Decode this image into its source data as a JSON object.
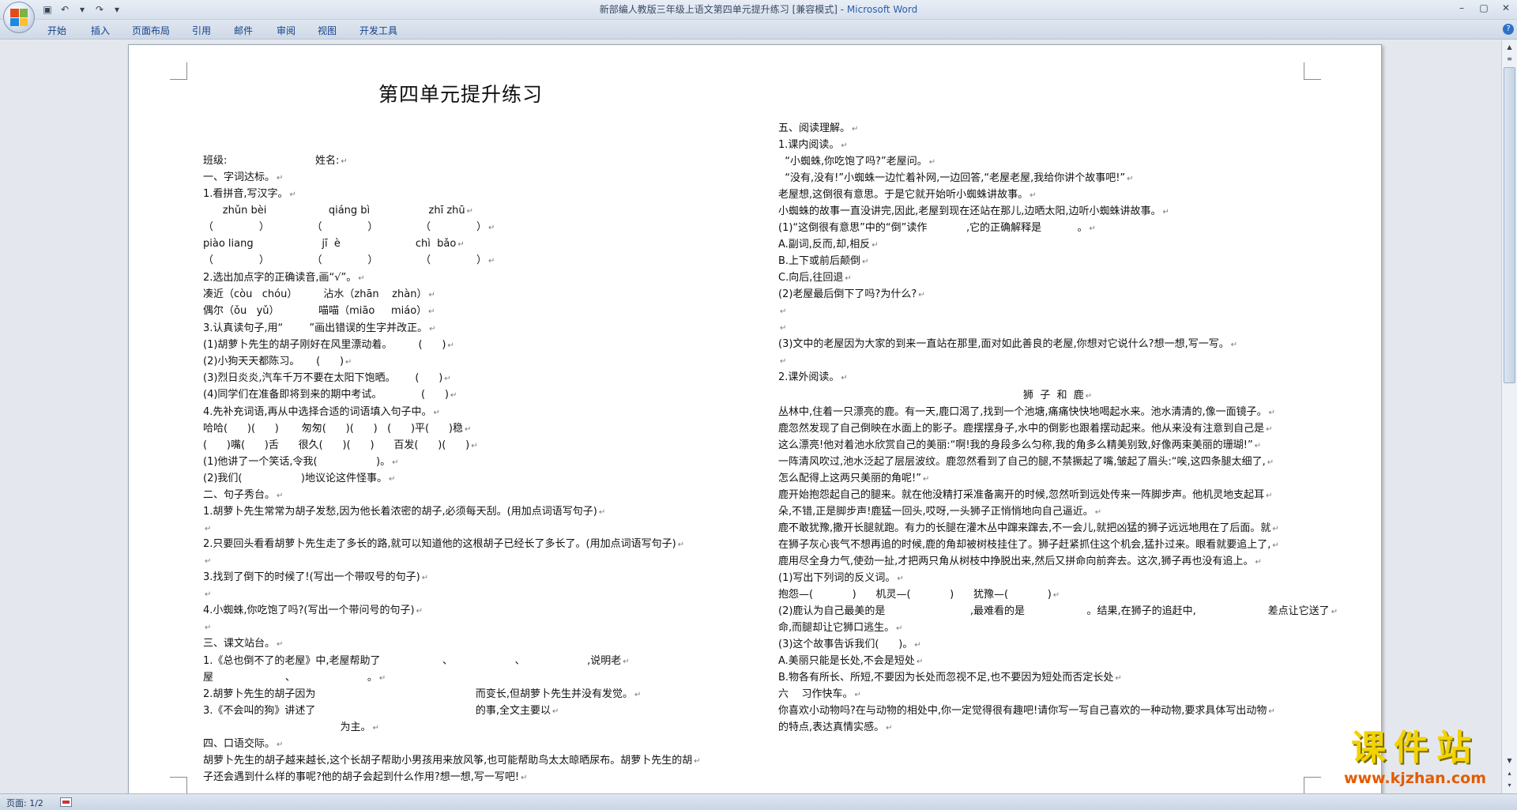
{
  "window": {
    "title_doc": "新部编人教版三年级上语文第四单元提升练习 [兼容模式] - ",
    "title_app": "Microsoft Word"
  },
  "ribbon": {
    "tabs": [
      "开始",
      "插入",
      "页面布局",
      "引用",
      "邮件",
      "审阅",
      "视图",
      "开发工具"
    ]
  },
  "status": {
    "page_label": "页面: 1/2"
  },
  "watermark": {
    "title": "课件站",
    "url": "www.kjzhan.com"
  },
  "document": {
    "title": "第四单元提升练习",
    "left_lines": [
      "班级:                           姓名:",
      "一、字词达标。",
      "1.看拼音,写汉字。",
      "      zhǔn bèi                   qiáng bì                  zhī zhū",
      "（              ）             （              ）             （              ）",
      "piào liang                     jī  è                       chì  bǎo",
      "（              ）             （              ）             （              ）",
      "2.选出加点字的正确读音,画“√”。",
      "凑近（còu   chóu）        沾水（zhān    zhàn）",
      "偶尔（ǒu   yǔ）            喵喵（miāo     miáo）",
      "3.认真读句子,用“        ”画出错误的生字并改正。",
      "(1)胡萝卜先生的胡子刚好在风里漂动着。        (      )",
      "(2)小狗天天都陈习。     (      )",
      "(3)烈日炎炎,汽车千万不要在太阳下饱晒。      (      )",
      "(4)同学们在准备即将到来的期中考试。            (      )",
      "4.先补充词语,再从中选择合适的词语填入句子中。",
      "哈哈(      )(      )       匆匆(      )(      )   (      )平(      )稳",
      "(      )嘴(      )舌      很久(      )(      )      百发(      )(      )",
      "(1)他讲了一个笑话,令我(                  )。",
      "(2)我们(                  )地议论这件怪事。",
      "二、句子秀台。",
      "1.胡萝卜先生常常为胡子发愁,因为他长着浓密的胡子,必须每天刮。(用加点词语写句子)",
      "",
      "2.只要回头看看胡萝卜先生走了多长的路,就可以知道他的这根胡子已经长了多长了。(用加点词语写句子)",
      "",
      "3.找到了倒下的时候了!(写出一个带叹号的句子)",
      "",
      "4.小蜘蛛,你吃饱了吗?(写出一个带问号的句子)",
      "",
      "三、课文站台。",
      "1.《总也倒不了的老屋》中,老屋帮助了                   、                   、                   ,说明老",
      "屋                      、                      。",
      "2.胡萝卜先生的胡子因为                                                 而变长,但胡萝卜先生并没有发觉。",
      "3.《不会叫的狗》讲述了                                                 的事,全文主要以",
      "                                          为主。",
      "四、口语交际。",
      "胡萝卜先生的胡子越来越长,这个长胡子帮助小男孩用来放风筝,也可能帮助鸟太太晾晒尿布。胡萝卜先生的胡",
      "子还会遇到什么样的事呢?他的胡子会起到什么作用?想一想,写一写吧!"
    ],
    "right_lines": [
      "五、阅读理解。",
      "1.课内阅读。",
      "  “小蜘蛛,你吃饱了吗?”老屋问。",
      "  “没有,没有!”小蜘蛛一边忙着补网,一边回答,“老屋老屋,我给你讲个故事吧!”",
      "老屋想,这倒很有意思。于是它就开始听小蜘蛛讲故事。",
      "小蜘蛛的故事一直没讲完,因此,老屋到现在还站在那儿,边晒太阳,边听小蜘蛛讲故事。",
      "(1)“这倒很有意思”中的“倒”读作            ,它的正确解释是           。",
      "A.副词,反而,却,相反",
      "B.上下或前后颠倒",
      "C.向后,往回退",
      "(2)老屋最后倒下了吗?为什么?",
      "",
      "",
      "(3)文中的老屋因为大家的到来一直站在那里,面对如此善良的老屋,你想对它说什么?想一想,写一写。",
      "",
      "2.课外阅读。",
      "                                                                           狮  子  和  鹿",
      "丛林中,住着一只漂亮的鹿。有一天,鹿口渴了,找到一个池塘,痛痛快快地喝起水来。池水清清的,像一面镜子。",
      "鹿忽然发现了自己倒映在水面上的影子。鹿摆摆身子,水中的倒影也跟着摆动起来。他从来没有注意到自己是",
      "这么漂亮!他对着池水欣赏自己的美丽:“啊!我的身段多么匀称,我的角多么精美别致,好像两束美丽的珊瑚!”",
      "一阵清风吹过,池水泛起了层层波纹。鹿忽然看到了自己的腿,不禁撅起了嘴,皱起了眉头:“唉,这四条腿太细了,",
      "怎么配得上这两只美丽的角呢!”",
      "鹿开始抱怨起自己的腿来。就在他没精打采准备离开的时候,忽然听到远处传来一阵脚步声。他机灵地支起耳",
      "朵,不错,正是脚步声!鹿猛一回头,哎呀,一头狮子正悄悄地向自己逼近。",
      "鹿不敢犹豫,撒开长腿就跑。有力的长腿在灌木丛中蹿来蹿去,不一会儿,就把凶猛的狮子远远地甩在了后面。就",
      "在狮子灰心丧气不想再追的时候,鹿的角却被树枝挂住了。狮子赶紧抓住这个机会,猛扑过来。眼看就要追上了,",
      "鹿用尽全身力气,使劲一扯,才把两只角从树枝中挣脱出来,然后又拼命向前奔去。这次,狮子再也没有追上。",
      "(1)写出下列词的反义词。",
      "抱怨—(            )      机灵—(            )      犹豫—(            )",
      "(2)鹿认为自己最美的是                          ,最难看的是                   。结果,在狮子的追赶中,                      差点让它送了",
      "命,而腿却让它狮口逃生。",
      "(3)这个故事告诉我们(      )。",
      "A.美丽只能是长处,不会是短处",
      "B.物各有所长、所短,不要因为长处而忽视不足,也不要因为短处而否定长处",
      "六    习作快车。",
      "你喜欢小动物吗?在与动物的相处中,你一定觉得很有趣吧!请你写一写自己喜欢的一种动物,要求具体写出动物",
      "的特点,表达真情实感。"
    ]
  }
}
